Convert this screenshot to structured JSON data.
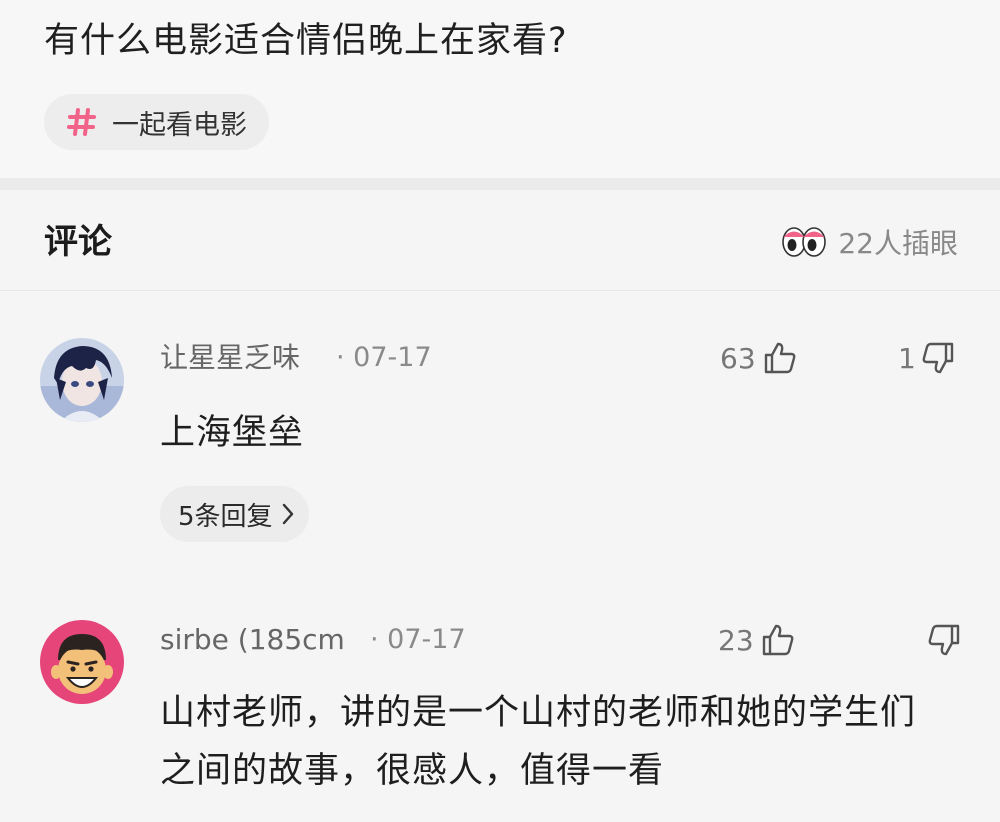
{
  "question": {
    "title": "有什么电影适合情侣晚上在家看?",
    "topic": "一起看电影"
  },
  "comments_header": {
    "title": "评论",
    "watchers_text": "22人插眼"
  },
  "comments": [
    {
      "username": "让星星乏味",
      "date": "· 07-17",
      "likes": "63",
      "dislikes": "1",
      "text": "上海堡垒",
      "replies_label": "5条回复"
    },
    {
      "username": "sirbe (185cm",
      "date": "· 07-17",
      "likes": "23",
      "dislikes": "",
      "text": "山村老师，讲的是一个山村的老师和她的学生们之间的故事，很感人，值得一看"
    }
  ],
  "colors": {
    "background": "#f5f5f5",
    "hash_pink": "#f2638a",
    "text_primary": "#222222",
    "text_secondary": "#888888"
  },
  "icons": {
    "topic": "hash-icon",
    "watchers": "eyes-icon",
    "like": "thumbs-up-icon",
    "dislike": "thumbs-down-icon",
    "replies": "chevron-right-icon"
  }
}
